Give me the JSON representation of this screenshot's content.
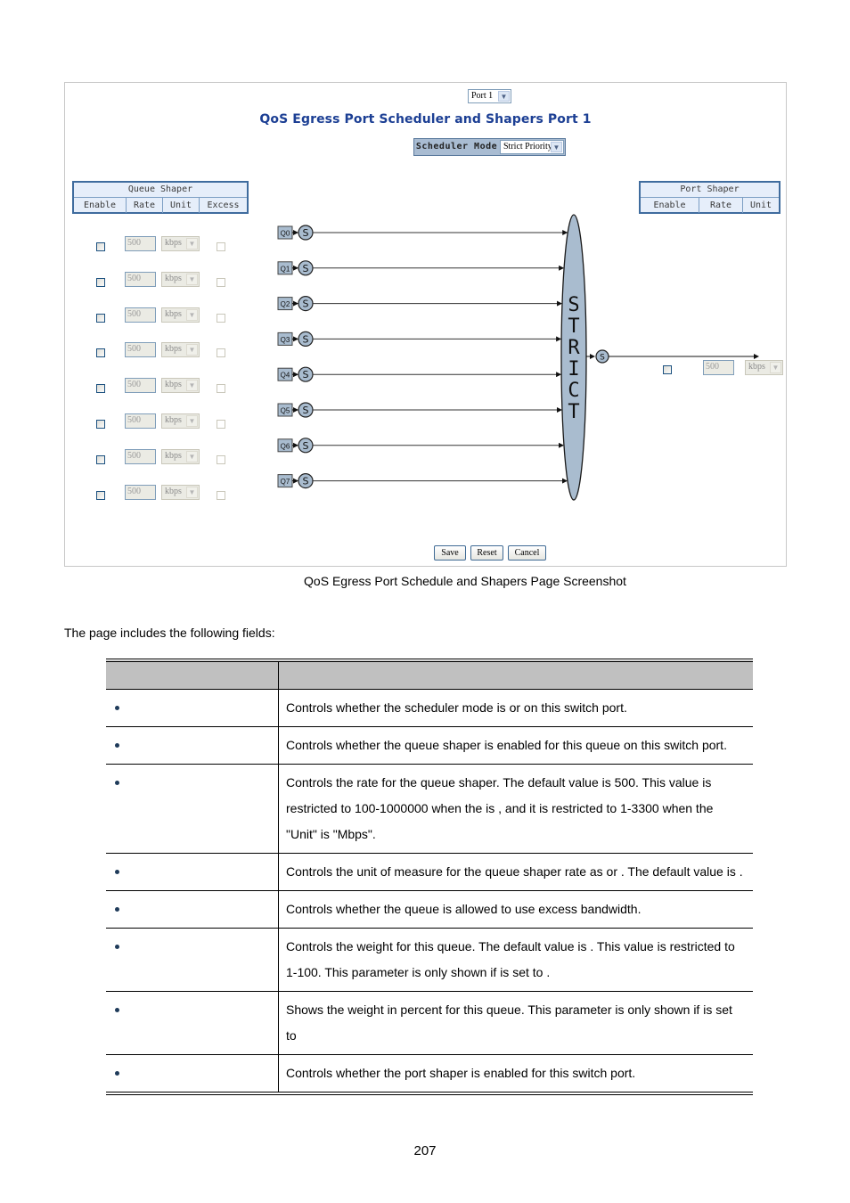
{
  "screenshot": {
    "port_select": {
      "value": "Port 1"
    },
    "title": "QoS Egress Port Scheduler and Shapers  Port 1",
    "scheduler_mode": {
      "label": "Scheduler Mode",
      "value": "Strict Priority"
    },
    "queue_shaper": {
      "title": "Queue Shaper",
      "columns": [
        "Enable",
        "Rate",
        "Unit",
        "Excess"
      ],
      "rows": [
        {
          "queue": "Q0",
          "enable": false,
          "rate": "500",
          "unit": "kbps",
          "excess": false
        },
        {
          "queue": "Q1",
          "enable": false,
          "rate": "500",
          "unit": "kbps",
          "excess": false
        },
        {
          "queue": "Q2",
          "enable": false,
          "rate": "500",
          "unit": "kbps",
          "excess": false
        },
        {
          "queue": "Q3",
          "enable": false,
          "rate": "500",
          "unit": "kbps",
          "excess": false
        },
        {
          "queue": "Q4",
          "enable": false,
          "rate": "500",
          "unit": "kbps",
          "excess": false
        },
        {
          "queue": "Q5",
          "enable": false,
          "rate": "500",
          "unit": "kbps",
          "excess": false
        },
        {
          "queue": "Q6",
          "enable": false,
          "rate": "500",
          "unit": "kbps",
          "excess": false
        },
        {
          "queue": "Q7",
          "enable": false,
          "rate": "500",
          "unit": "kbps",
          "excess": false
        }
      ]
    },
    "diagram": {
      "shaper_symbol": "S",
      "scheduler_letters": [
        "S",
        "T",
        "R",
        "I",
        "C",
        "T"
      ],
      "colors": {
        "fill": "#a9bccf",
        "stroke": "#1a1a1a"
      }
    },
    "port_shaper": {
      "title": "Port Shaper",
      "columns": [
        "Enable",
        "Rate",
        "Unit"
      ],
      "enable": false,
      "rate": "500",
      "unit": "kbps"
    },
    "buttons": {
      "save": "Save",
      "reset": "Reset",
      "cancel": "Cancel"
    }
  },
  "caption": "QoS Egress Port Schedule and Shapers Page Screenshot",
  "intro": "The page includes the following fields:",
  "fields_table": {
    "headers": [
      "",
      ""
    ],
    "rows": [
      {
        "object": "",
        "description": "Controls whether the scheduler mode is                        or                    on this switch port."
      },
      {
        "object": "",
        "description": "Controls whether the queue shaper is enabled for this queue on this switch port."
      },
      {
        "object": "",
        "description": "Controls the rate for the queue shaper. The default value is 500. This value is restricted to 100-1000000 when the           is           , and it is restricted to 1-3300 when the \"Unit\" is \"Mbps\"."
      },
      {
        "object": "",
        "description": "Controls the unit of measure for the queue shaper rate as            or           . The default value is           ."
      },
      {
        "object": "",
        "description": "Controls whether the queue is allowed to use excess bandwidth."
      },
      {
        "object": "",
        "description": "Controls the weight for this queue. The default value is        . This value is restricted to 1-100. This parameter is only shown if                               is set to                   ."
      },
      {
        "object": "",
        "description": "Shows the weight in percent for this queue. This parameter is only shown if                         is set to"
      },
      {
        "object": "",
        "description": "Controls whether the port shaper is enabled for this switch port."
      }
    ]
  },
  "page_number": "207"
}
